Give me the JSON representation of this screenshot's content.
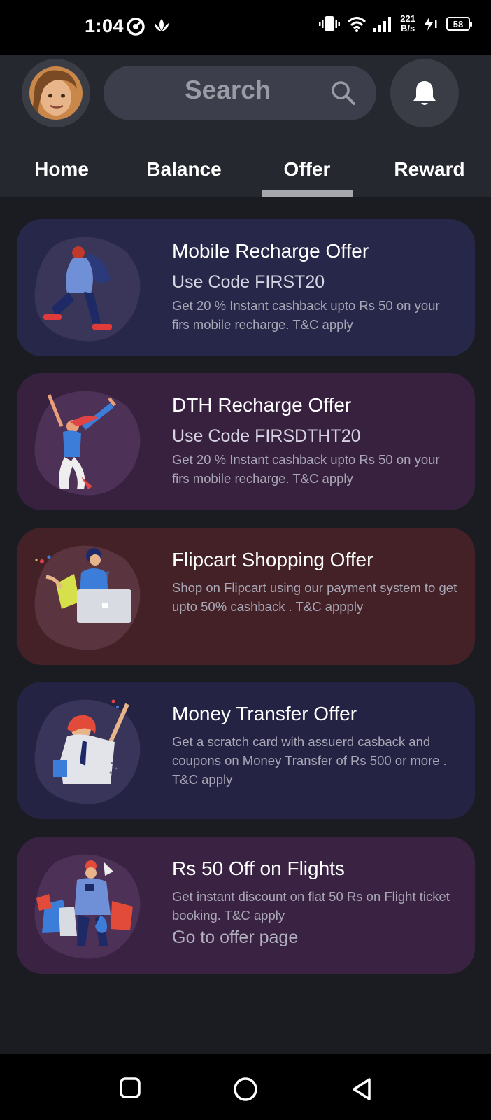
{
  "status_bar": {
    "time": "1:04",
    "speed_value": "221",
    "speed_unit": "B/s",
    "battery": "58"
  },
  "header": {
    "search_placeholder": "Search",
    "tabs": [
      {
        "label": "Home",
        "active": false
      },
      {
        "label": "Balance",
        "active": false
      },
      {
        "label": "Offer",
        "active": true
      },
      {
        "label": "Reward",
        "active": false
      }
    ]
  },
  "offers": [
    {
      "title": "Mobile Recharge Offer",
      "code": "Use Code FIRST20",
      "description": "Get 20 % Instant cashback upto Rs 50 on your firs mobile recharge. T&C apply",
      "bg_color": "#272849"
    },
    {
      "title": "DTH Recharge Offer",
      "code": "Use Code FIRSDTHT20",
      "description": "Get 20 % Instant cashback upto Rs 50 on your firs mobile recharge. T&C apply",
      "bg_color": "#38213f"
    },
    {
      "title": "Flipcart Shopping Offer",
      "description": "Shop on Flipcart using our payment system to get upto 50% cashback . T&C appply",
      "bg_color": "#432127"
    },
    {
      "title": "Money Transfer Offer",
      "description": "Get a scratch card with assuerd casback and coupons on Money Transfer of Rs 500 or more . T&C apply",
      "bg_color": "#252344"
    },
    {
      "title": "Rs 50 Off on Flights",
      "description": "Get instant discount on flat 50 Rs on Flight ticket booking. T&C apply",
      "link": "Go to offer page",
      "bg_color": "#3a2243"
    }
  ],
  "icons": {
    "search": "search-icon",
    "bell": "bell-icon",
    "nav_recents": "square-icon",
    "nav_home": "circle-icon",
    "nav_back": "triangle-back-icon"
  }
}
